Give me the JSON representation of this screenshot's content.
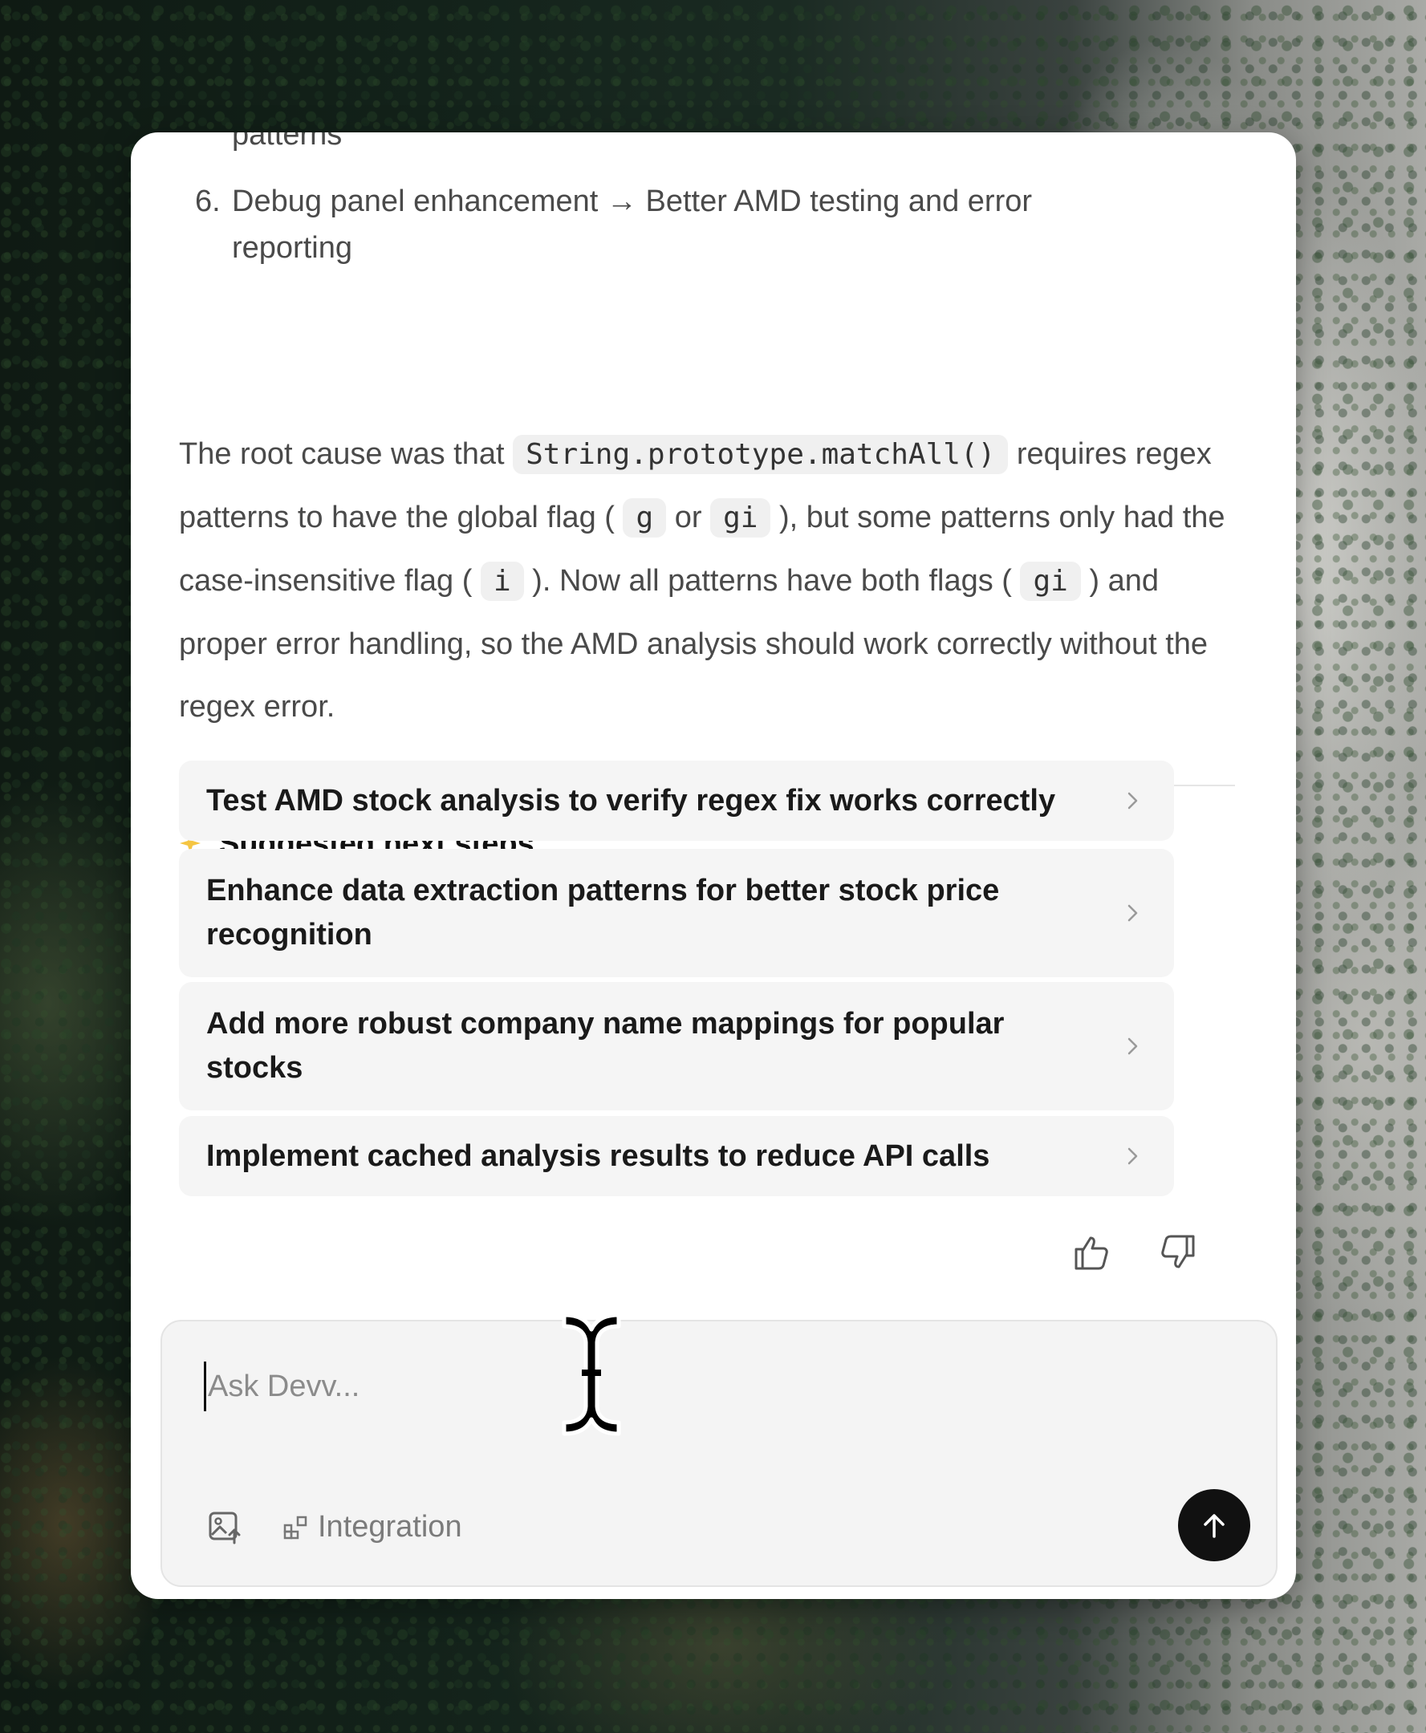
{
  "message": {
    "cut_text": "patterns",
    "list_item": {
      "number": "6.",
      "text": "Debug panel enhancement → Better AMD testing and error reporting"
    },
    "paragraph": {
      "t1": "The root cause was that ",
      "c1": "String.prototype.matchAll()",
      "t2": " requires regex patterns to have the global flag ( ",
      "c2": "g",
      "t3": " or ",
      "c3": "gi",
      "t4": " ), but some patterns only had the case-insensitive flag ( ",
      "c4": "i",
      "t5": " ). Now all patterns have both flags ( ",
      "c5": "gi",
      "t6": " ) and proper error handling, so the AMD analysis should work correctly without the regex error."
    }
  },
  "suggested": {
    "icon": "sparkle-icon",
    "title": "Suggested next steps",
    "items": [
      "Test AMD stock analysis to verify regex fix works correctly",
      "Enhance data extraction patterns for better stock price recognition",
      "Add more robust company name mappings for popular stocks",
      "Implement cached analysis results to reduce API calls"
    ]
  },
  "feedback": {
    "like_icon": "thumbs-up-icon",
    "dislike_icon": "thumbs-down-icon"
  },
  "composer": {
    "placeholder": "Ask Devv...",
    "value": "",
    "image_icon": "image-upload-icon",
    "integration_label": "Integration",
    "send_icon": "arrow-up-icon"
  },
  "colors": {
    "panel_bg": "#ffffff",
    "step_bg": "#f5f5f5",
    "send_bg": "#111111",
    "sparkle": "#f5c542"
  }
}
